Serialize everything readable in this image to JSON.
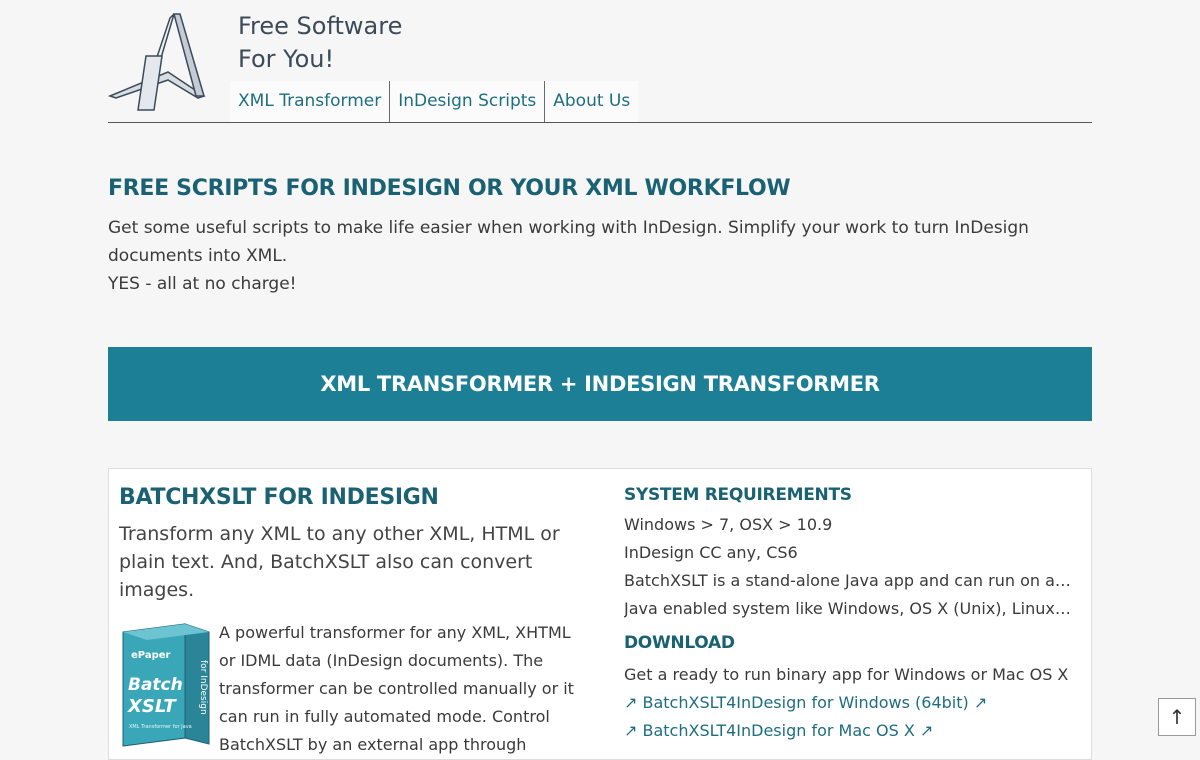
{
  "header": {
    "tagline_line1": "Free Software",
    "tagline_line2": "For You!",
    "logo_icon": "ametys-a-logo-icon"
  },
  "nav": {
    "items": [
      {
        "label": "XML Transformer"
      },
      {
        "label": "InDesign Scripts"
      },
      {
        "label": "About Us"
      }
    ]
  },
  "intro": {
    "heading": "FREE SCRIPTS FOR INDESIGN OR YOUR XML WORKFLOW",
    "paragraph1": "Get some useful scripts to make life easier when working with InDesign. Simplify your work to turn InDesign documents into XML.",
    "paragraph2": "YES - all at no charge!"
  },
  "banner": {
    "label": "XML TRANSFORMER + INDESIGN TRANSFORMER"
  },
  "product": {
    "title": "BATCHXSLT FOR INDESIGN",
    "lead": "Transform any XML to any other XML, HTML or plain text. And, BatchXSLT also can convert images.",
    "description": "A powerful transformer for any XML, XHTML or IDML data (InDesign documents). The transformer can be controlled manually or it can run in fully automated mode. Control BatchXSLT by an external app through",
    "boxart": {
      "brand": "ePaper",
      "name_line1": "Batch",
      "name_line2": "XSLT",
      "side_text": "for InDesign",
      "caption": "XML Transformer for Java"
    }
  },
  "requirements": {
    "heading": "SYSTEM REQUIREMENTS",
    "lines": [
      "Windows > 7, OSX > 10.9",
      "InDesign CC any, CS6",
      "BatchXSLT is a stand-alone Java app and can run on any",
      "Java enabled system like Windows, OS X (Unix), Linux ..."
    ]
  },
  "download": {
    "heading": "DOWNLOAD",
    "text": "Get a ready to run binary app for Windows or Mac OS X",
    "links": [
      {
        "label": "↗ BatchXSLT4InDesign for Windows (64bit) ↗"
      },
      {
        "label": "↗ BatchXSLT4InDesign for Mac OS X ↗"
      }
    ]
  },
  "scroll_top": {
    "label": "↑",
    "icon": "arrow-up-icon"
  }
}
